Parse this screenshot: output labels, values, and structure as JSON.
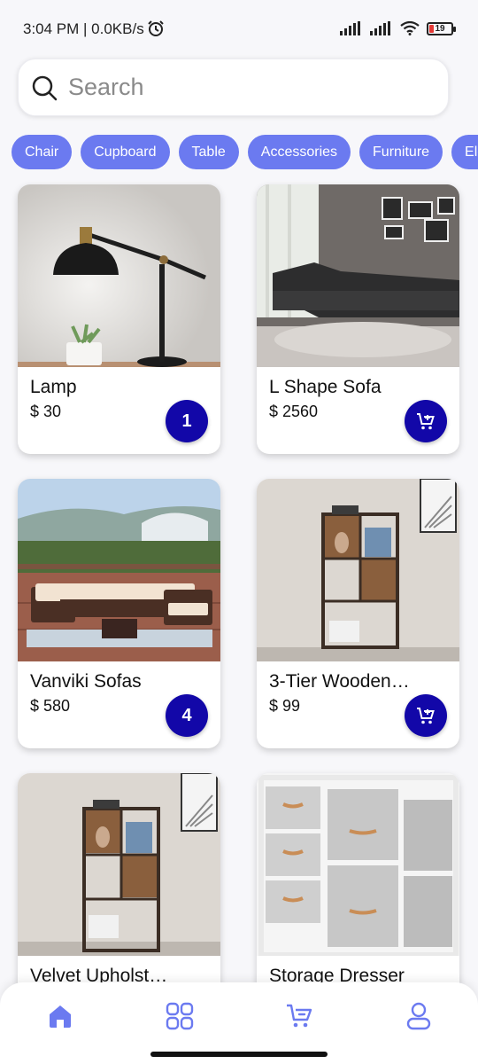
{
  "status_bar": {
    "time": "3:04 PM | 0.0KB/s",
    "battery_level": "19"
  },
  "search": {
    "placeholder": "Search"
  },
  "categories": [
    "Chair",
    "Cupboard",
    "Table",
    "Accessories",
    "Furniture",
    "Electronics"
  ],
  "products": [
    {
      "name": "Lamp",
      "price": "$ 30",
      "cart_count": "1",
      "in_cart": true
    },
    {
      "name": "L Shape Sofa",
      "price": "$ 2560",
      "cart_count": "",
      "in_cart": false
    },
    {
      "name": "Vanviki Sofas",
      "price": "$ 580",
      "cart_count": "4",
      "in_cart": true
    },
    {
      "name": "3-Tier Wooden…",
      "price": "$ 99",
      "cart_count": "",
      "in_cart": false
    },
    {
      "name": "Velvet Upholst…",
      "price": "",
      "cart_count": "",
      "in_cart": false
    },
    {
      "name": "Storage Dresser",
      "price": "",
      "cart_count": "",
      "in_cart": false
    }
  ],
  "bottom_nav": [
    {
      "icon": "home-icon",
      "active": true
    },
    {
      "icon": "grid-icon",
      "active": false
    },
    {
      "icon": "cart-icon",
      "active": false
    },
    {
      "icon": "profile-icon",
      "active": false
    }
  ],
  "colors": {
    "accent": "#6b7af0",
    "primary_dark": "#1207a8",
    "background": "#f7f7fa"
  }
}
